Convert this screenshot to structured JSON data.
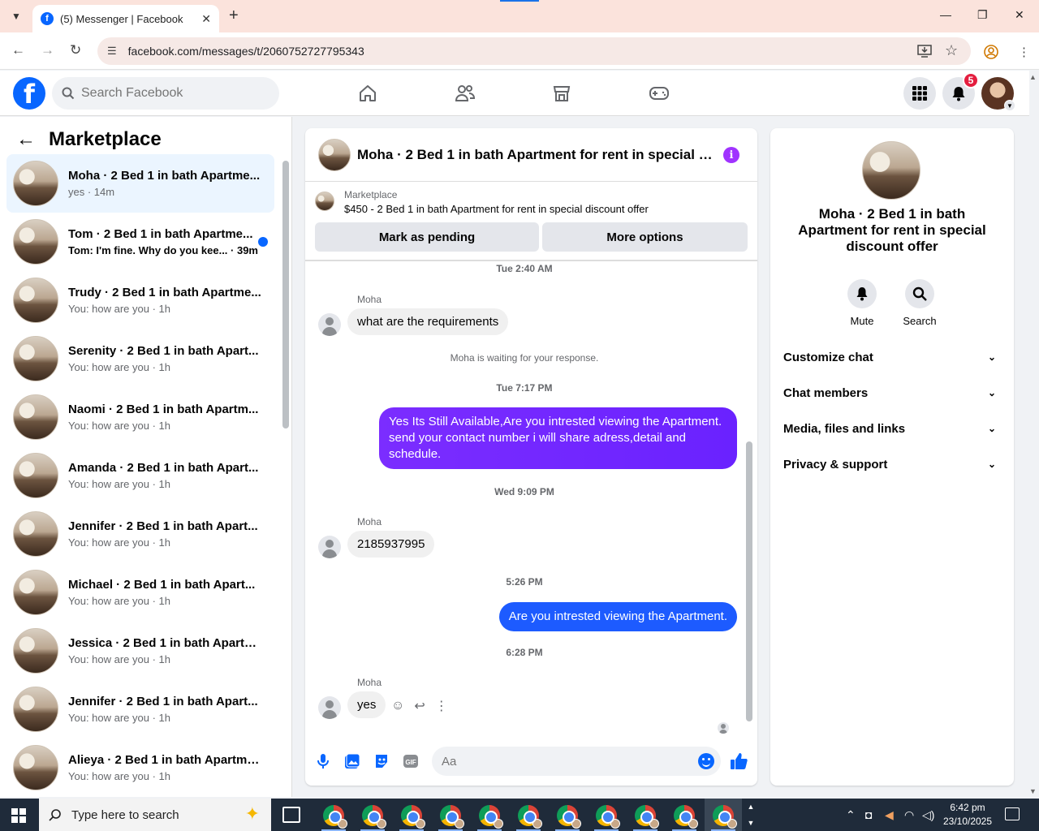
{
  "browser": {
    "tab_title": "(5) Messenger | Facebook",
    "url": "facebook.com/messages/t/2060752727795343"
  },
  "fb_header": {
    "search_placeholder": "Search Facebook",
    "notification_count": "5"
  },
  "left": {
    "title": "Marketplace",
    "chats": [
      {
        "name": "Moha · 2 Bed 1 in bath Apartme...",
        "preview": "yes · 14m",
        "active": true,
        "unread": false
      },
      {
        "name": "Tom · 2 Bed 1 in bath Apartme...",
        "preview": "Tom: I'm fine. Why do you kee... · 39m",
        "active": false,
        "unread": true
      },
      {
        "name": "Trudy · 2 Bed 1 in bath Apartme...",
        "preview": "You: how are you · 1h",
        "active": false,
        "unread": false
      },
      {
        "name": "Serenity · 2 Bed 1 in bath Apart...",
        "preview": "You: how are you · 1h",
        "active": false,
        "unread": false
      },
      {
        "name": "Naomi · 2 Bed 1 in bath Apartm...",
        "preview": "You: how are you · 1h",
        "active": false,
        "unread": false
      },
      {
        "name": "Amanda · 2 Bed 1 in bath Apart...",
        "preview": "You: how are you · 1h",
        "active": false,
        "unread": false
      },
      {
        "name": "Jennifer · 2 Bed 1 in bath Apart...",
        "preview": "You: how are you · 1h",
        "active": false,
        "unread": false
      },
      {
        "name": "Michael · 2 Bed 1 in bath Apart...",
        "preview": "You: how are you · 1h",
        "active": false,
        "unread": false
      },
      {
        "name": "Jessica · 2 Bed 1 in bath Apartm...",
        "preview": "You: how are you · 1h",
        "active": false,
        "unread": false
      },
      {
        "name": "Jennifer · 2 Bed 1 in bath Apart...",
        "preview": "You: how are you · 1h",
        "active": false,
        "unread": false
      },
      {
        "name": "Alieya · 2 Bed 1 in bath Apartme...",
        "preview": "You: how are you · 1h",
        "active": false,
        "unread": false
      }
    ]
  },
  "conversation": {
    "title": "Moha · 2 Bed 1 in bath Apartment for rent in special di...",
    "marketplace_label": "Marketplace",
    "listing": "$450 - 2 Bed 1 in bath Apartment for rent in special discount offer",
    "mark_pending": "Mark as pending",
    "more_options": "More options",
    "ts1": "Tue 2:40 AM",
    "sender1": "Moha",
    "msg1": "what are the requirements",
    "waiting": "Moha is waiting for your response.",
    "ts2": "Tue 7:17 PM",
    "out1": "Yes Its Still Available,Are you intrested viewing the Apartment. send your contact number i will share adress,detail and schedule.",
    "ts3": "Wed 9:09 PM",
    "sender2": "Moha",
    "msg2": "2185937995",
    "ts4": "5:26 PM",
    "out2": "Are you intrested viewing the Apartment.",
    "ts5": "6:28 PM",
    "sender3": "Moha",
    "msg3": "yes",
    "composer_placeholder": "Aa"
  },
  "details": {
    "name": "Moha · 2 Bed 1 in bath Apartment for rent in special discount offer",
    "mute": "Mute",
    "search": "Search",
    "sections": [
      "Customize chat",
      "Chat members",
      "Media, files and links",
      "Privacy & support"
    ]
  },
  "taskbar": {
    "search_placeholder": "Type here to search",
    "time": "6:42 pm",
    "date": "23/10/2025"
  },
  "colors": {
    "fb_blue": "#0866ff",
    "outgoing_purple": "#6a22ff",
    "outgoing_blue": "#1d5bff",
    "active_chat_bg": "#ebf5ff"
  }
}
